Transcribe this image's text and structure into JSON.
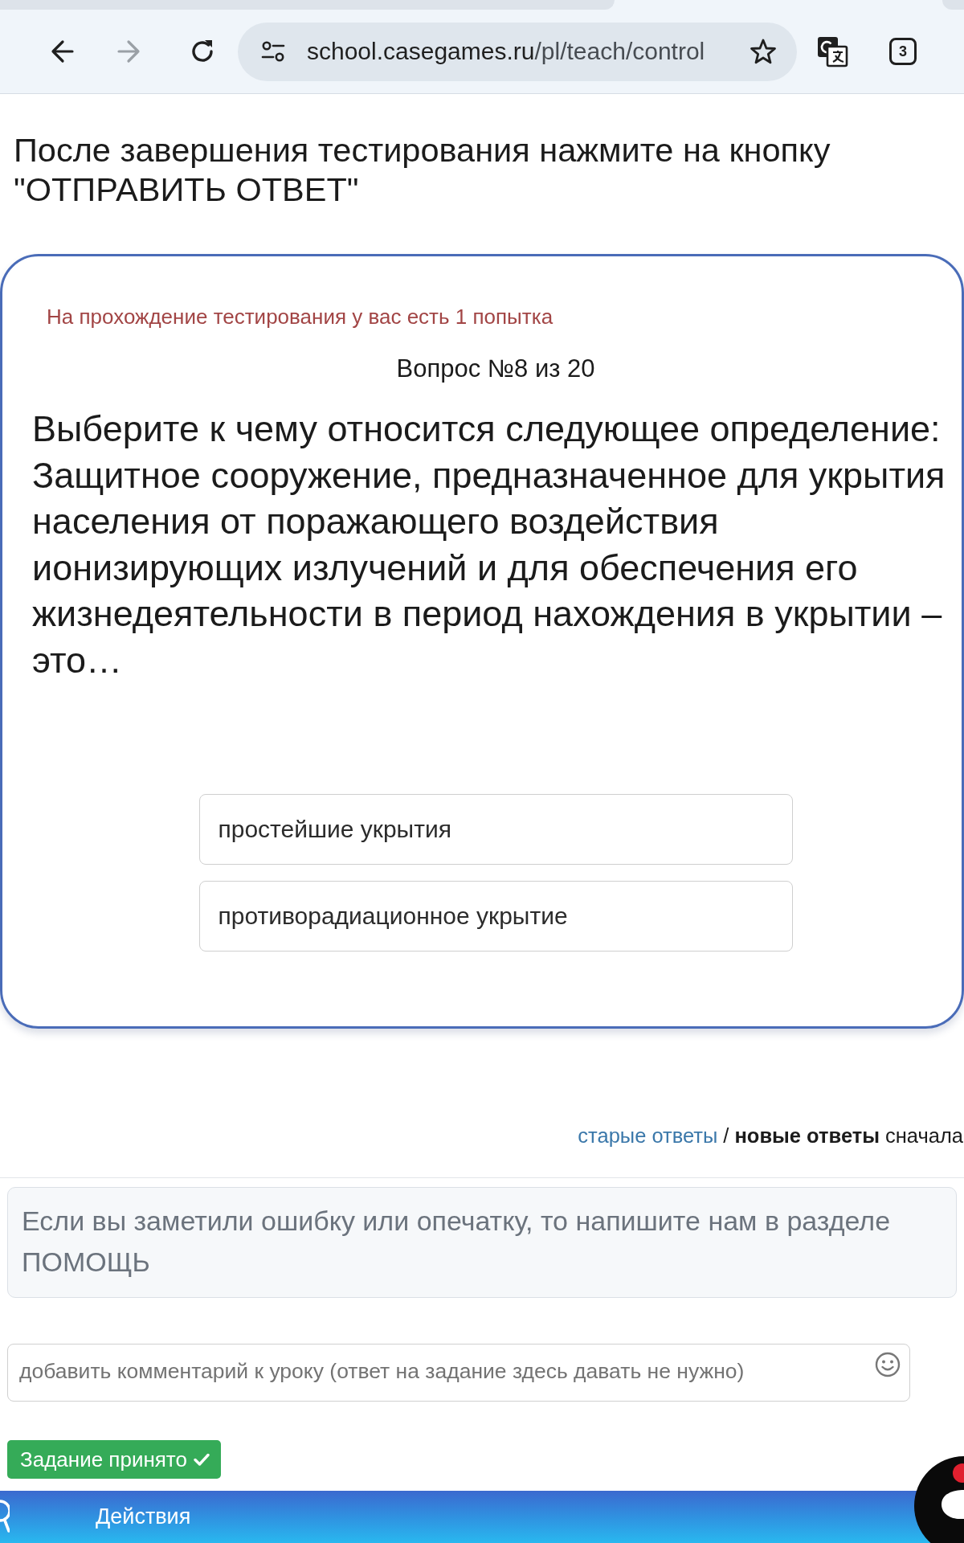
{
  "browser": {
    "nav": [
      {
        "kind": "back",
        "disabled": false
      },
      {
        "kind": "forward",
        "disabled": true
      },
      {
        "kind": "reload",
        "disabled": false
      }
    ],
    "url_host": "school.casegames.ru",
    "url_path": "/pl/teach/control",
    "tab_count": "3"
  },
  "instruction": "После завершения тестирования нажмите на кнопку \"ОТПРАВИТЬ ОТВЕТ\"",
  "quiz": {
    "attempts_note": "На прохождение тестирования у вас есть 1 попытка",
    "question_counter": "Вопрос №8 из 20",
    "question": "Выберите к чему относится следующее определение: Защитное сооружение, предназначенное для укрытия населения от поражающего воздействия ионизирующих излучений и для обеспечения его жизнедеятельности в период нахождения в укрытии – это…",
    "options": [
      {
        "label": "простейшие укрытия",
        "selected": false
      },
      {
        "label": "противорадиационное укрытие",
        "selected": false
      }
    ]
  },
  "sort": [
    {
      "kind": "link",
      "text": "старые ответы"
    },
    {
      "kind": "separator",
      "text": "/"
    },
    {
      "kind": "current",
      "text": "новые ответы"
    },
    {
      "kind": "plain",
      "text": "сначала"
    }
  ],
  "notice": {
    "text": "Если вы заметили ошибку или опечатку, то напишите нам в разделе ПОМОЩЬ"
  },
  "comment": {
    "placeholder": "добавить комментарий к уроку (ответ на задание здесь давать не нужно)"
  },
  "status_button": {
    "label": "Задание принято"
  },
  "bottom_bar": {
    "label": "Действия"
  },
  "chat": {
    "unread": true
  }
}
